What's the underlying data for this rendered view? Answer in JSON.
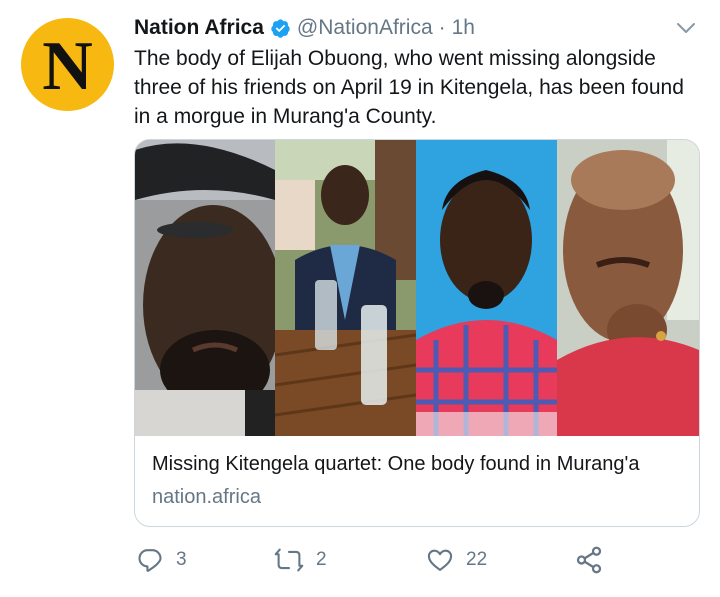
{
  "tweet": {
    "avatar_letter": "N",
    "display_name": "Nation Africa",
    "handle": "@NationAfrica",
    "separator": "·",
    "time": "1h",
    "text": "The body of Elijah Obuong, who went missing alongside three of his friends on April 19 in Kitengela, has been found in a morgue in Murang'a County."
  },
  "card": {
    "title": "Missing Kitengela quartet: One body found in Murang'a",
    "domain": "nation.africa"
  },
  "actions": {
    "reply_count": "3",
    "retweet_count": "2",
    "like_count": "22"
  },
  "icons": {
    "verified": "verified-badge-icon",
    "menu": "chevron-down-icon",
    "reply": "reply-icon",
    "retweet": "retweet-icon",
    "like": "heart-icon",
    "share": "share-icon"
  },
  "colors": {
    "avatar_bg": "#f7b812",
    "verified": "#1da1f2",
    "secondary_text": "#657786",
    "border": "#ccd6dd"
  }
}
